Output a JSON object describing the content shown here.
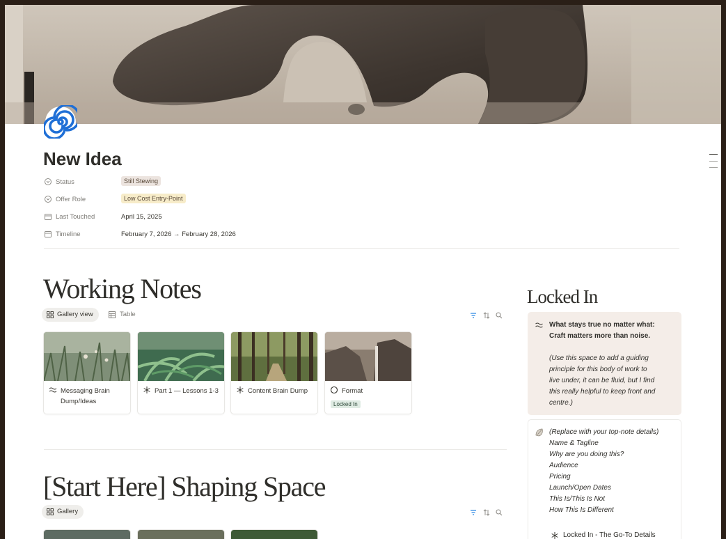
{
  "page": {
    "title": "New Idea",
    "icon": "spiral-icon"
  },
  "properties": [
    {
      "label": "Status",
      "value": "Still Stewing",
      "icon": "status-icon",
      "tag_color": "#ece4df"
    },
    {
      "label": "Offer Role",
      "value": "Low Cost Entry-Point",
      "icon": "status-icon",
      "tag_color": "#f7ecc9"
    },
    {
      "label": "Last Touched",
      "value": "April 15, 2025",
      "icon": "calendar-icon"
    },
    {
      "label": "Timeline",
      "value": "February 7, 2026 → February 28, 2026",
      "icon": "calendar-icon"
    }
  ],
  "working_notes": {
    "heading": "Working Notes",
    "views": [
      {
        "label": "Gallery view",
        "icon": "gallery-icon",
        "active": true
      },
      {
        "label": "Table",
        "icon": "table-icon",
        "active": false
      }
    ],
    "cards": [
      {
        "title": "Messaging Brain Dump/Ideas",
        "icon": "waves-icon",
        "tag": ""
      },
      {
        "title": "Part 1 — Lessons 1-3",
        "icon": "asterisk-icon",
        "tag": ""
      },
      {
        "title": "Content Brain Dump",
        "icon": "asterisk-icon",
        "tag": ""
      },
      {
        "title": "Format",
        "icon": "circle-icon",
        "tag": "Locked In"
      }
    ]
  },
  "shaping_space": {
    "heading": "[Start Here] Shaping Space",
    "views": [
      {
        "label": "Gallery",
        "icon": "gallery-icon",
        "active": true
      }
    ]
  },
  "locked_in": {
    "heading": "Locked In",
    "callout1": {
      "icon": "waves-icon",
      "bold_line1": "What stays true no matter what:",
      "bold_line2": "Craft matters more than noise.",
      "italic_lines": [
        "(Use this space to add a guiding",
        "principle for this body of work to",
        "live under, it can be fluid, but I find",
        "this really helpful to keep front and",
        "centre.)"
      ]
    },
    "callout2": {
      "icon": "shell-icon",
      "lines": [
        "(Replace with your top-note details)",
        "Name & Tagline",
        "Why are you doing this?",
        "Audience",
        "Pricing",
        "Launch/Open Dates",
        "This Is/This Is Not",
        "How This Is Different"
      ],
      "footer": "Locked In - The Go-To Details"
    }
  },
  "colors": {
    "accent_blue": "#2383e2",
    "text": "#37352f",
    "muted": "#7d7b76"
  }
}
